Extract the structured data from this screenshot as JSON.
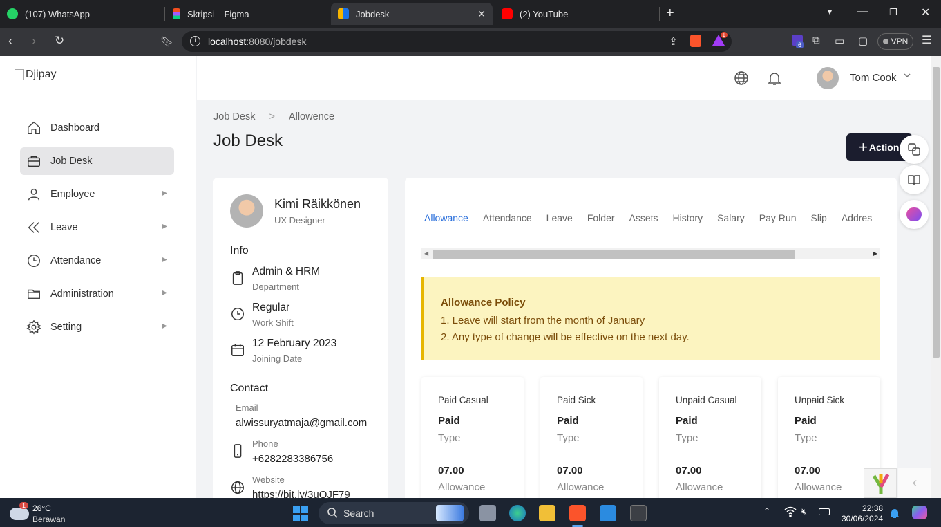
{
  "browser": {
    "tabs": [
      {
        "label": "(107) WhatsApp",
        "icon": "whatsapp-icon",
        "color": "#25d366"
      },
      {
        "label": "Skripsi – Figma",
        "icon": "figma-icon",
        "color": "#f24e1e"
      },
      {
        "label": "Jobdesk",
        "icon": "app-favicon",
        "color": "#f7b500",
        "active": true
      },
      {
        "label": "(2) YouTube",
        "icon": "youtube-icon",
        "color": "#ff0000"
      }
    ],
    "url_host": "localhost",
    "url_path": ":8080/jobdesk",
    "brave_badge": "1",
    "ext_badge": "6",
    "vpn_label": "VPN"
  },
  "sidebar": {
    "logo_alt": "Djipay",
    "items": [
      {
        "label": "Dashboard",
        "icon": "home-icon"
      },
      {
        "label": "Job Desk",
        "icon": "briefcase-icon",
        "active": true
      },
      {
        "label": "Employee",
        "icon": "user-icon",
        "has_children": true
      },
      {
        "label": "Leave",
        "icon": "double-chevron-left-icon",
        "has_children": true
      },
      {
        "label": "Attendance",
        "icon": "clock-icon",
        "has_children": true
      },
      {
        "label": "Administration",
        "icon": "folder-icon",
        "has_children": true
      },
      {
        "label": "Setting",
        "icon": "gear-icon",
        "has_children": true
      }
    ]
  },
  "header": {
    "user_name": "Tom Cook"
  },
  "breadcrumb": [
    "Job Desk",
    "Allowence"
  ],
  "page_title": "Job Desk",
  "action_label": "Action",
  "profile": {
    "name": "Kimi Räikkönen",
    "role": "UX Designer",
    "info_title": "Info",
    "department": {
      "value": "Admin & HRM",
      "label": "Department"
    },
    "work_shift": {
      "value": "Regular",
      "label": "Work Shift"
    },
    "joining_date": {
      "value": "12 February 2023",
      "label": "Joining Date"
    },
    "contact_title": "Contact",
    "email": {
      "label": "Email",
      "value": "alwissuryatmaja@gmail.com"
    },
    "phone": {
      "label": "Phone",
      "value": "+6282283386756"
    },
    "website": {
      "label": "Website",
      "value": "https://bit.ly/3uOJF79"
    }
  },
  "tabs": [
    "Allowance",
    "Attendance",
    "Leave",
    "Folder",
    "Assets",
    "History",
    "Salary",
    "Pay Run",
    "Slip",
    "Addres"
  ],
  "active_tab": "Allowance",
  "policy": {
    "title": "Allowance Policy",
    "lines": [
      "1. Leave will start from the month of January",
      "2. Any type of change will be effective on the next day."
    ]
  },
  "leave_cards": [
    {
      "title": "Paid Casual",
      "status": "Paid",
      "status_label": "Type",
      "amount": "07.00",
      "amount_label": "Allowance"
    },
    {
      "title": "Paid Sick",
      "status": "Paid",
      "status_label": "Type",
      "amount": "07.00",
      "amount_label": "Allowance"
    },
    {
      "title": "Unpaid Casual",
      "status": "Paid",
      "status_label": "Type",
      "amount": "07.00",
      "amount_label": "Allowance"
    },
    {
      "title": "Unpaid Sick",
      "status": "Paid",
      "status_label": "Type",
      "amount": "07.00",
      "amount_label": "Allowance"
    }
  ],
  "taskbar": {
    "weather_temp": "26°C",
    "weather_desc": "Berawan",
    "weather_badge": "1",
    "search_label": "Search",
    "time": "22:38",
    "date": "30/06/2024"
  }
}
